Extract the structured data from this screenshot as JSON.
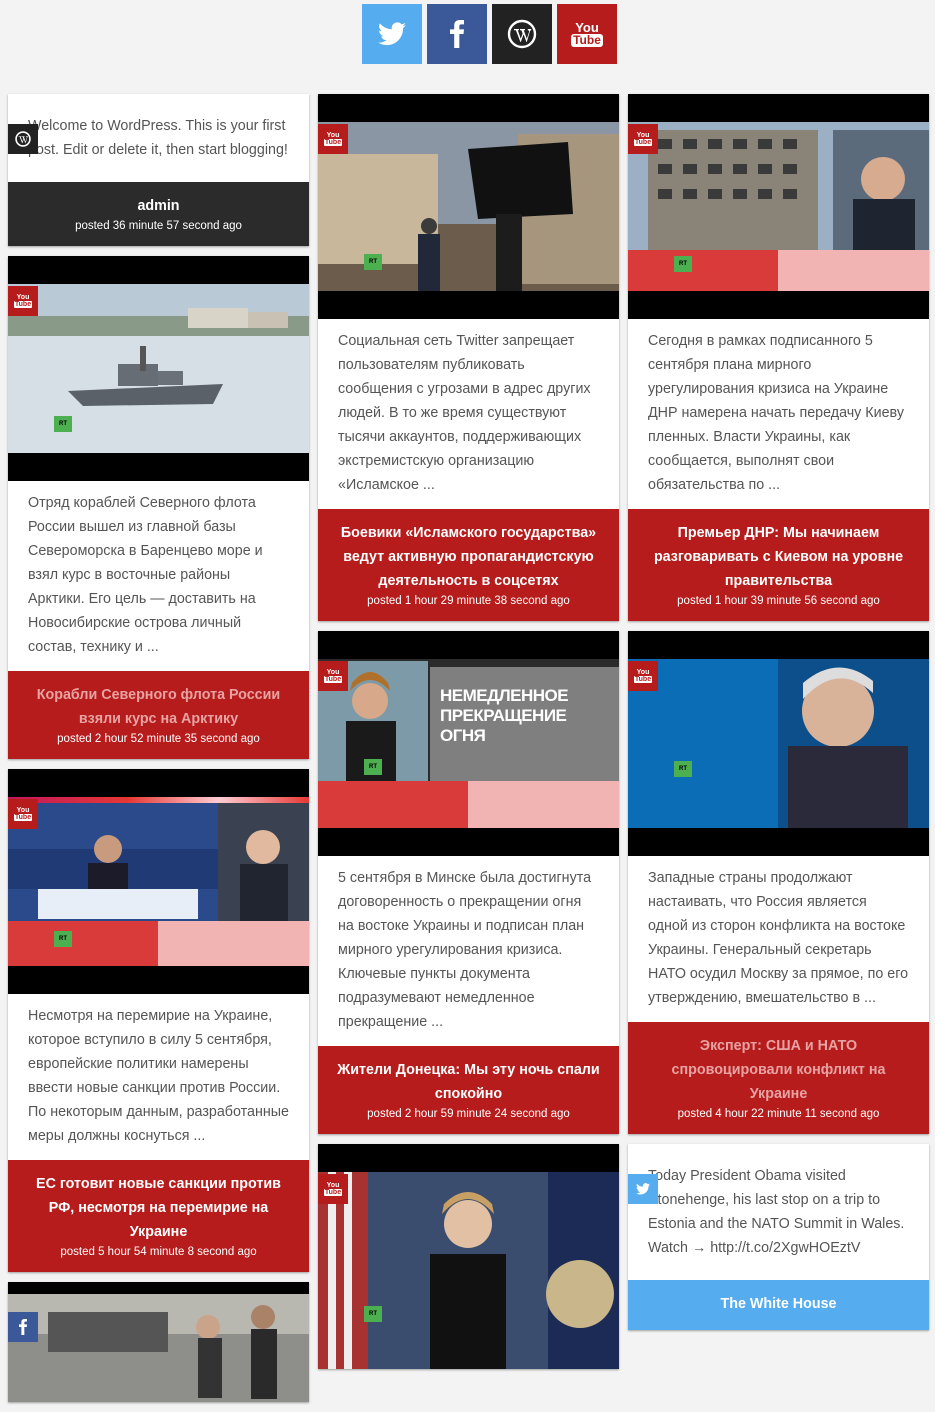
{
  "social": {
    "items": [
      {
        "name": "twitter",
        "color": "#55acee"
      },
      {
        "name": "facebook",
        "color": "#3b5998"
      },
      {
        "name": "wordpress",
        "color": "#222222"
      },
      {
        "name": "youtube",
        "color": "#b71c1c",
        "label_top": "You",
        "label_bottom": "Tube"
      }
    ]
  },
  "youtube_badge": {
    "top": "You",
    "bottom": "Tube"
  },
  "rt_logo": "RT",
  "col1": {
    "wp_card": {
      "source_icon": "wordpress-icon",
      "text": "Welcome to WordPress. This is your first post. Edit or delete it, then start blogging!",
      "author": "admin",
      "date": "posted 36 minute 57 second ago"
    },
    "card_fleet": {
      "source_icon": "youtube-icon",
      "text": "Отряд кораблей Северного флота России вышел из главной базы Североморска в Баренцево море и взял курс в восточные районы Арктики. Его цель — доставить на Новосибирские острова личный состав, технику и ...",
      "title": "Корабли Северного флота России взяли курс на Арктику",
      "date": "posted 2 hour 52 minute 35 second ago"
    },
    "card_eu": {
      "source_icon": "youtube-icon",
      "text": "Несмотря на перемирие на Украине, которое вступило в силу 5 сентября, европейские политики намерены ввести новые санкции против России. По некоторым данным, разработанные меры должны коснуться ...",
      "title": "ЕС готовит новые санкции против РФ, несмотря на перемирие на Украине",
      "date": "posted 5 hour 54 minute 8 second ago"
    },
    "card_fb": {
      "source_icon": "facebook-icon"
    }
  },
  "col2": {
    "card_twitter": {
      "source_icon": "youtube-icon",
      "text": "Социальная сеть Twitter запрещает пользователям публиковать сообщения с угрозами в адрес других людей. В то же время существуют тысячи аккаунтов, поддерживающих экстремистскую организацию «Исламское ...",
      "title": "Боевики «Исламского государства» ведут активную пропагандистскую деятельность в соцсетях",
      "date": "posted 1 hour 29 minute 38 second ago"
    },
    "card_donetsk": {
      "source_icon": "youtube-icon",
      "overlay": "НЕМЕДЛЕННОЕ ПРЕКРАЩЕНИЕ ОГНЯ",
      "text": "5 сентября в Минске была достигнута договоренность о прекращении огня на востоке Украины и подписан план мирного урегулирования кризиса. Ключевые пункты документа подразумевают немедленное прекращение ...",
      "title": "Жители Донецка: Мы эту ночь спали спокойно",
      "date": "posted 2 hour 59 minute 24 second ago"
    },
    "card_state": {
      "source_icon": "youtube-icon"
    }
  },
  "col3": {
    "card_dnr": {
      "source_icon": "youtube-icon",
      "text": "Сегодня в рамках подписанного 5 сентября плана мирного урегулирования кризиса на Украине ДНР намерена начать передачу Киеву пленных. Власти Украины, как сообщается, выполнят свои обязательства по ...",
      "title": "Премьер ДНР: Мы начинаем разговаривать с Киевом на уровне правительства",
      "date": "posted 1 hour 39 minute 56 second ago"
    },
    "card_nato": {
      "source_icon": "youtube-icon",
      "text": "Западные страны продолжают настаивать, что Россия является одной из сторон конфликта на востоке Украины. Генеральный секретарь НАТО осудил Москву за прямое, по его утверждению, вмешательство в ...",
      "title": "Эксперт: США и НАТО спровоцировали конфликт на Украине",
      "date": "posted 4 hour 22 minute 11 second ago"
    },
    "card_obama": {
      "source_icon": "twitter-icon",
      "text": "Today President Obama visited Stonehenge, his last stop on a trip to Estonia and the NATO Summit in Wales. Watch → http://t.co/2XgwHOEztV",
      "author": "The White House"
    }
  }
}
